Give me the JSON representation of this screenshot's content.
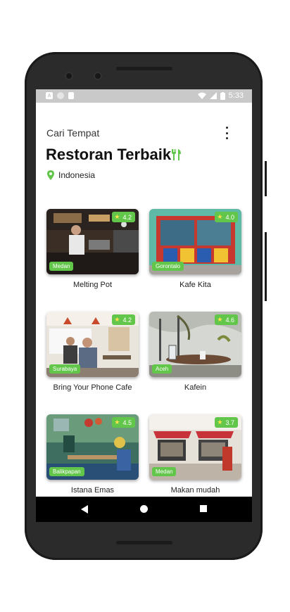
{
  "status_bar": {
    "time": "5:33",
    "left_icon_letter": "A"
  },
  "header": {
    "subtitle": "Cari Tempat",
    "title": "Restoran Terbaik",
    "location": "Indonesia",
    "accent_color": "#62c64b"
  },
  "restaurants": [
    {
      "name": "Melting Pot",
      "city": "Medan",
      "rating": "4.2"
    },
    {
      "name": "Kafe Kita",
      "city": "Gorontalo",
      "rating": "4.0"
    },
    {
      "name": "Bring Your Phone Cafe",
      "city": "Surabaya",
      "rating": "4.2"
    },
    {
      "name": "Kafein",
      "city": "Aceh",
      "rating": "4.6"
    },
    {
      "name": "Istana Emas",
      "city": "Balikpapan",
      "rating": "4.5"
    },
    {
      "name": "Makan mudah",
      "city": "Medan",
      "rating": "3.7"
    }
  ],
  "icons": [
    "more-vert-icon",
    "fork-knife-icon",
    "location-pin-icon",
    "star-icon",
    "back-icon",
    "home-icon",
    "recents-icon"
  ]
}
